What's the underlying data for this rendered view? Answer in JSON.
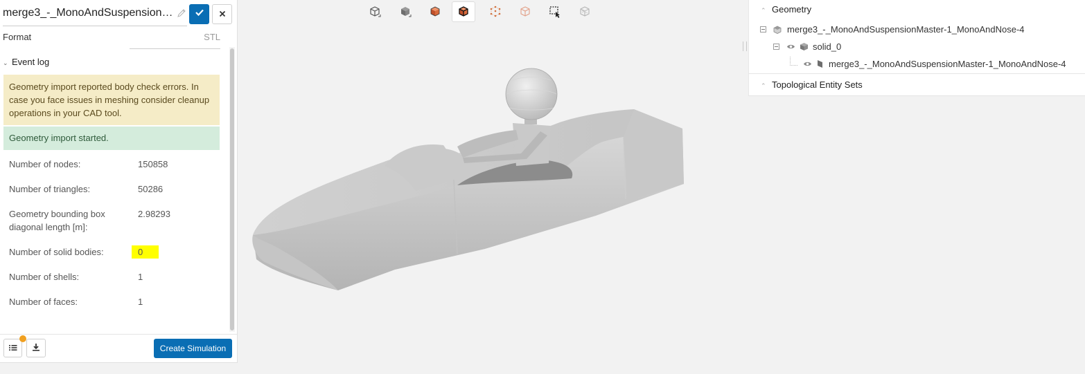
{
  "header": {
    "title": "merge3_-_MonoAndSuspensionMa...",
    "confirm_icon": "check-icon",
    "cancel_icon": "close-icon",
    "edit_icon": "pencil-icon"
  },
  "format": {
    "label": "Format",
    "value": "STL"
  },
  "event_log": {
    "title": "Event log",
    "messages": [
      {
        "type": "warning",
        "text": "Geometry import reported body check errors. In case you face issues in meshing consider cleanup operations in your CAD tool."
      },
      {
        "type": "success",
        "text": "Geometry import started."
      }
    ],
    "stats": [
      {
        "label": "Number of nodes:",
        "value": "150858"
      },
      {
        "label": "Number of triangles:",
        "value": "50286"
      },
      {
        "label": "Geometry bounding box diagonal length [m]:",
        "value": "2.98293"
      },
      {
        "label": "Number of solid bodies:",
        "value": "0"
      },
      {
        "label": "Number of shells:",
        "value": "1"
      },
      {
        "label": "Number of faces:",
        "value": "1"
      }
    ]
  },
  "footer": {
    "create_simulation": "Create Simulation",
    "list_icon": "list-icon",
    "download_icon": "download-icon"
  },
  "toolbar": {
    "tools": [
      "view-cube-icon",
      "solid-view-icon",
      "solid-highlight-icon",
      "selected-solid-icon",
      "point-select-icon",
      "wireframe-icon",
      "box-select-icon",
      "hidden-entity-icon"
    ]
  },
  "tree": {
    "geometry_title": "Geometry",
    "root": "merge3_-_MonoAndSuspensionMaster-1_MonoAndNose-4",
    "solid": "solid_0",
    "face": "merge3_-_MonoAndSuspensionMaster-1_MonoAndNose-4",
    "entity_sets_title": "Topological Entity Sets"
  },
  "colors": {
    "accent": "#0a6eb4",
    "warning_bg": "#f5ecc7",
    "success_bg": "#d4ecdc",
    "highlight": "#ffff00",
    "notification": "#f0a020"
  }
}
